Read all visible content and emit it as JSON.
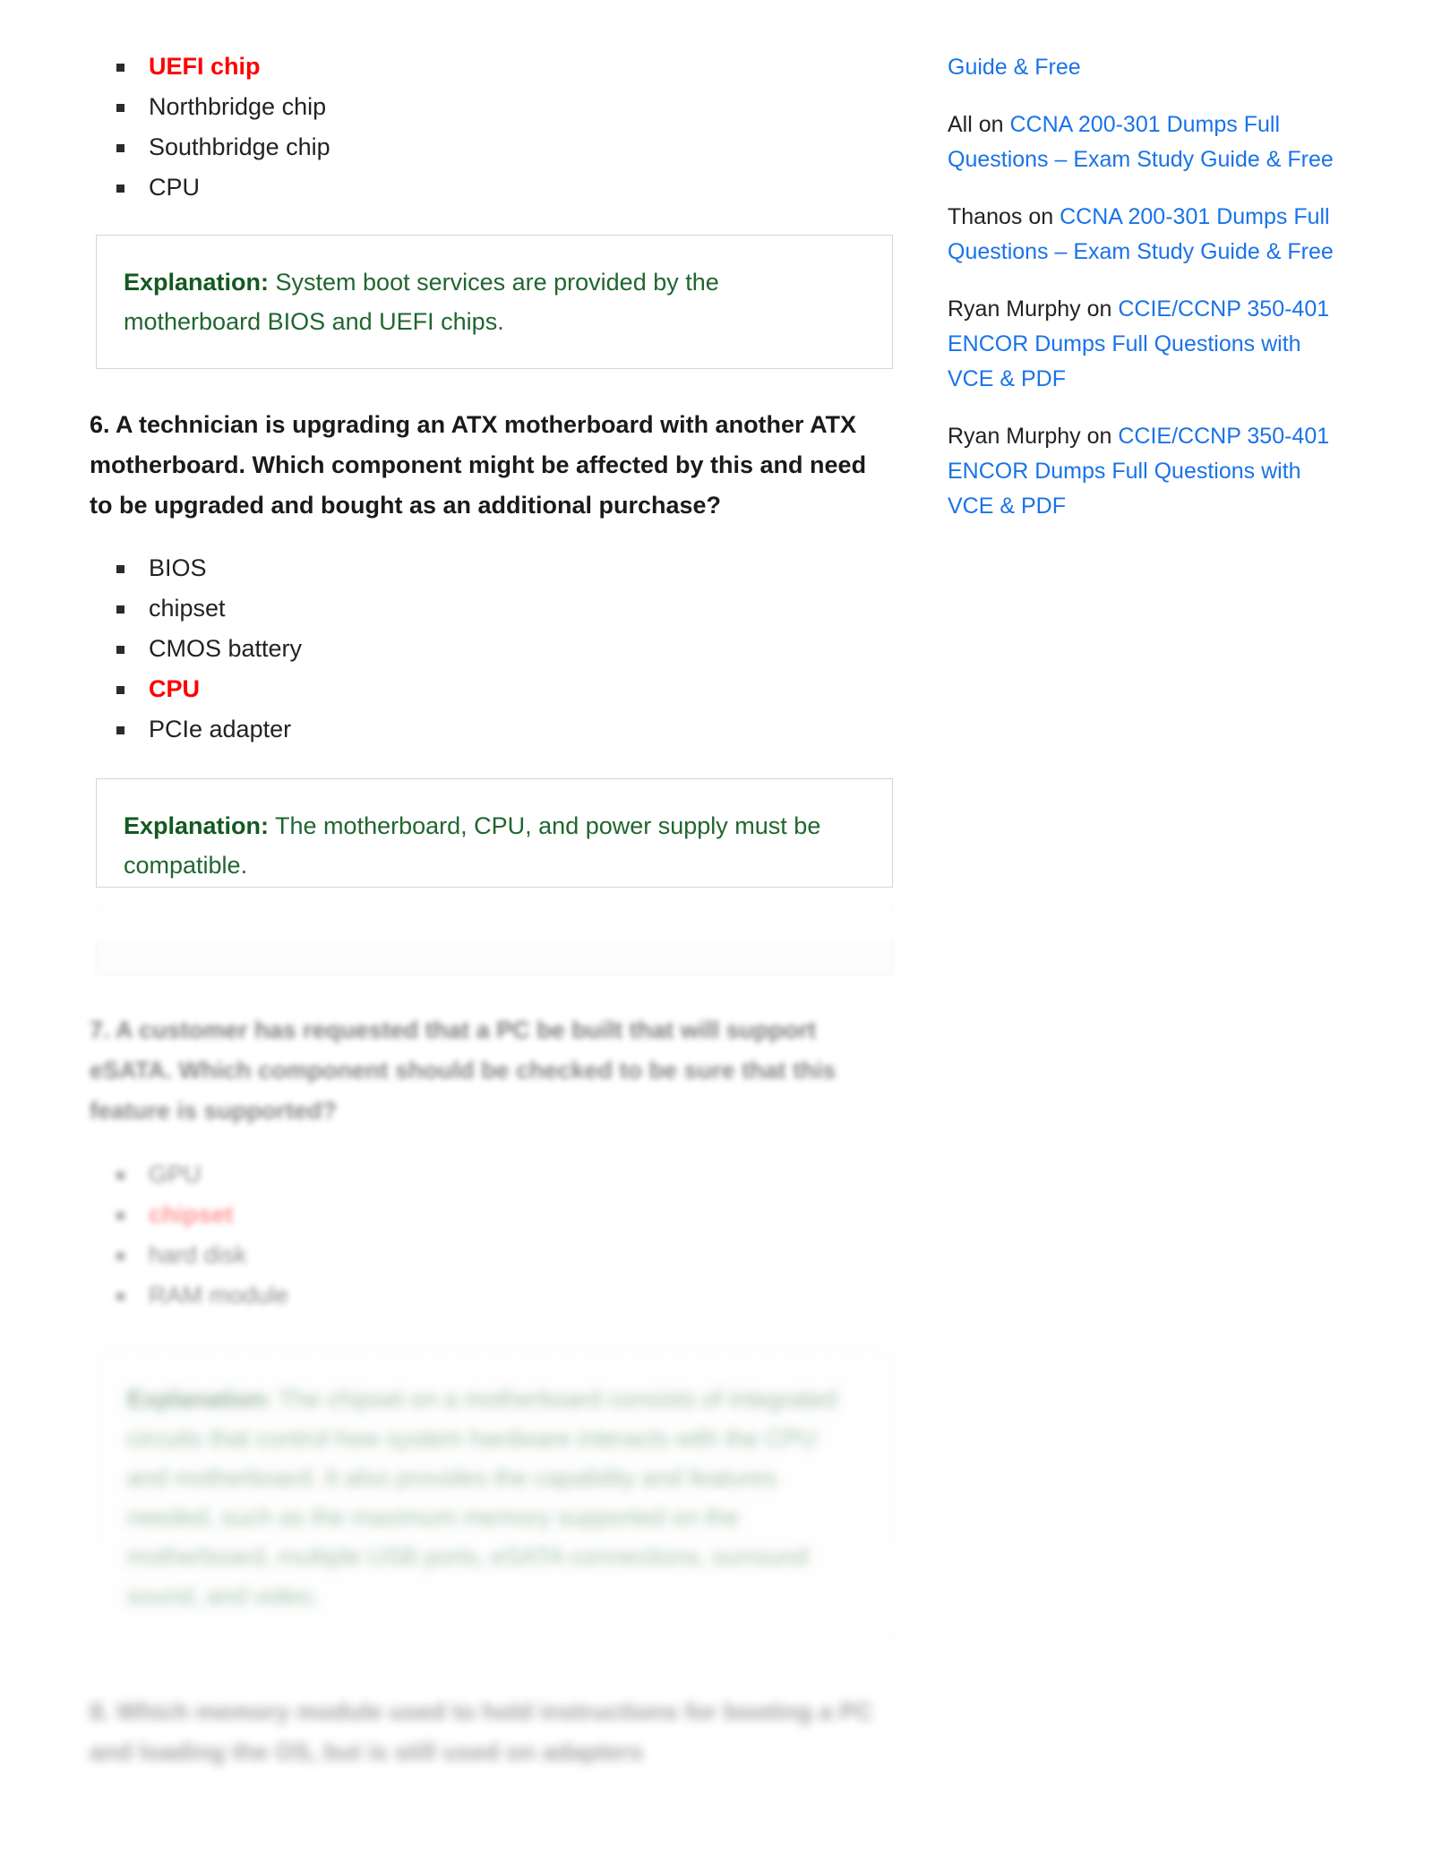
{
  "question5": {
    "answers": [
      {
        "text": "UEFI chip",
        "correct": true
      },
      {
        "text": "Northbridge chip",
        "correct": false
      },
      {
        "text": "Southbridge chip",
        "correct": false
      },
      {
        "text": "CPU",
        "correct": false
      }
    ],
    "explanation_label": "Explanation:",
    "explanation_text": " System boot services are provided by the motherboard BIOS and UEFI chips."
  },
  "question6": {
    "heading": "6. A technician is upgrading an ATX motherboard with another ATX motherboard. Which component might be affected by this and need to be upgraded and bought as an additional purchase?",
    "answers": [
      {
        "text": "BIOS",
        "correct": false
      },
      {
        "text": "chipset",
        "correct": false
      },
      {
        "text": "CMOS battery",
        "correct": false
      },
      {
        "text": "CPU",
        "correct": true
      },
      {
        "text": "PCIe adapter",
        "correct": false
      }
    ],
    "explanation_label": "Explanation:",
    "explanation_text": " The motherboard, CPU, and power supply must be compatible."
  },
  "question7": {
    "heading": "7. A customer has requested that a PC be built that will support eSATA. Which component should be checked to be sure that this feature is supported?",
    "answers": [
      {
        "text": "GPU",
        "correct": false
      },
      {
        "text": "chipset",
        "correct": true
      },
      {
        "text": "hard disk",
        "correct": false
      },
      {
        "text": "RAM module",
        "correct": false
      }
    ],
    "explanation_label": "Explanation:",
    "explanation_text": " The chipset on a motherboard consists of integrated circuits that control how system hardware interacts with the CPU and motherboard. It also provides the capability and features needed, such as the maximum memory supported on the motherboard, multiple USB ports, eSATA connections, surround sound, and video."
  },
  "question8": {
    "heading": "8. Which memory module used to hold instructions for booting a PC and loading the OS, but is still used on adapters"
  },
  "sidebar": {
    "items": [
      {
        "prefix": "",
        "link": "Guide & Free",
        "suffix": "",
        "link_only": true
      },
      {
        "prefix": "All on ",
        "link": "CCNA 200-301 Dumps Full Questions – Exam Study Guide & Free",
        "suffix": ""
      },
      {
        "prefix": "Thanos on ",
        "link": "CCNA 200-301 Dumps Full Questions – Exam Study Guide & Free",
        "suffix": ""
      },
      {
        "prefix": "Ryan Murphy on ",
        "link": "CCIE/CCNP 350-401 ENCOR Dumps Full Questions with VCE & PDF",
        "suffix": ""
      },
      {
        "prefix": "Ryan Murphy on ",
        "link": "CCIE/CCNP 350-401 ENCOR Dumps Full Questions with VCE & PDF",
        "suffix": ""
      }
    ]
  },
  "colors": {
    "correct_answer": "#ff0000",
    "explanation_text": "#20662f",
    "link": "#1a73e8",
    "explanation_border": "#c9ddc9"
  }
}
